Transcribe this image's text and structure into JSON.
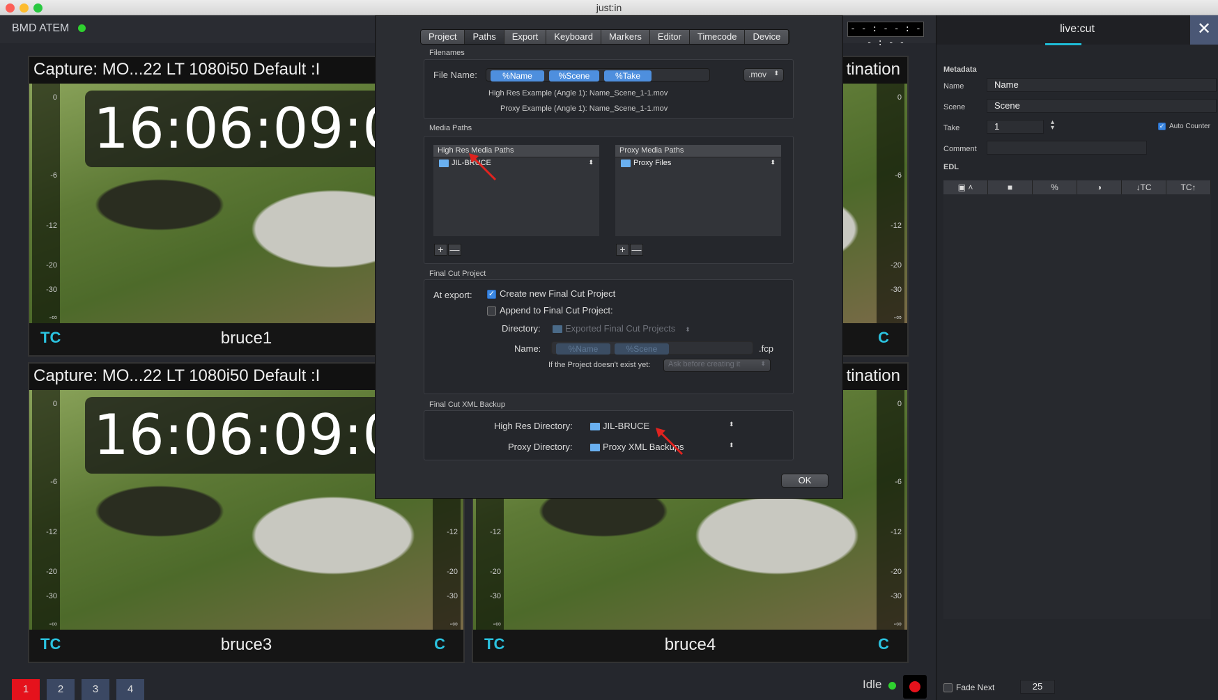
{
  "window": {
    "title": "just:in"
  },
  "topbar": {
    "device": "BMD ATEM",
    "timecode": "- - : - - : - - : - -"
  },
  "tiles": [
    {
      "caption": "Capture: MO...22 LT 1080i50    Default :I",
      "clock": "16:06:09:0",
      "tc": "TC",
      "name": "bruce1",
      "c": ""
    },
    {
      "caption": "tination",
      "clock": "",
      "tc": "",
      "name": "",
      "c": "C"
    },
    {
      "caption": "Capture: MO...22 LT 1080i50    Default :I",
      "clock": "16:06:09:0",
      "tc": "TC",
      "name": "bruce3",
      "c": "C"
    },
    {
      "caption": "tination",
      "clock": "",
      "tc": "TC",
      "name": "bruce4",
      "c": "C"
    }
  ],
  "meter_ticks": [
    "0",
    "-6",
    "-12",
    "-20",
    "-30",
    "-∞"
  ],
  "bottom": {
    "buttons": [
      "1",
      "2",
      "3",
      "4"
    ],
    "status": "Idle"
  },
  "side": {
    "title": "live:cut",
    "close": "✕",
    "metadata_label": "Metadata",
    "fields": {
      "name_label": "Name",
      "name_value": "Name",
      "scene_label": "Scene",
      "scene_value": "Scene",
      "take_label": "Take",
      "take_value": "1",
      "comment_label": "Comment"
    },
    "auto_counter": "Auto Counter",
    "edl_label": "EDL",
    "edl_columns": [
      "",
      "",
      "%",
      "",
      "↓TC",
      "TC↑"
    ],
    "fade_next": "Fade Next",
    "fade_value": "25"
  },
  "prefs": {
    "tabs": [
      "Project",
      "Paths",
      "Export",
      "Keyboard",
      "Markers",
      "Editor",
      "Timecode",
      "Device"
    ],
    "active_tab": "Paths",
    "filenames": {
      "section": "Filenames",
      "file_name_label": "File Name:",
      "tokens": [
        "%Name",
        "%Scene",
        "%Take"
      ],
      "extension": ".mov",
      "high_res_example": "High Res Example (Angle 1):  Name_Scene_1-1.mov",
      "proxy_example": "Proxy Example (Angle 1):  Name_Scene_1-1.mov"
    },
    "media_paths": {
      "section": "Media Paths",
      "high_res_header": "High Res Media Paths",
      "high_res_item": "JIL-BRUCE",
      "proxy_header": "Proxy Media Paths",
      "proxy_item": "Proxy Files",
      "add": "+",
      "remove": "—"
    },
    "final_cut": {
      "section": "Final Cut Project",
      "at_export": "At export:",
      "create_new": "Create new Final Cut Project",
      "append": "Append to Final Cut Project:",
      "directory_label": "Directory:",
      "directory_value": "Exported Final Cut Projects",
      "name_label": "Name:",
      "name_tokens": [
        "%Name",
        "%Scene"
      ],
      "fcp_ext": ".fcp",
      "not_exist_label": "If the Project doesn't exist yet:",
      "not_exist_value": "Ask before creating it"
    },
    "xml_backup": {
      "section": "Final Cut XML Backup",
      "high_res_label": "High Res Directory:",
      "high_res_value": "JIL-BRUCE",
      "proxy_label": "Proxy Directory:",
      "proxy_value": "Proxy XML Backups"
    },
    "ok": "OK"
  },
  "colors": {
    "accent": "#1ebbd6",
    "token": "#4e8fde",
    "record": "#e5121c",
    "active_cam": "#e5121c",
    "status_green": "#2fd12f"
  }
}
